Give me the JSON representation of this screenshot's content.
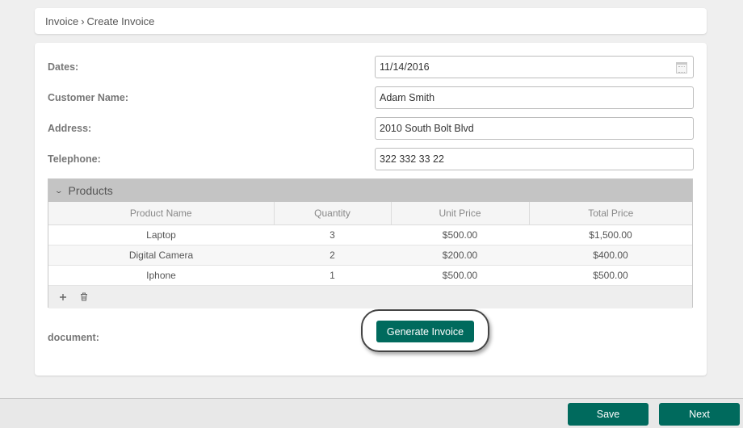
{
  "breadcrumb": {
    "parent": "Invoice",
    "separator": "›",
    "current": "Create Invoice"
  },
  "form": {
    "dates": {
      "label": "Dates:",
      "value": "11/14/2016"
    },
    "customer_name": {
      "label": "Customer Name:",
      "value": "Adam Smith"
    },
    "address": {
      "label": "Address:",
      "value": "2010 South Bolt Blvd"
    },
    "telephone": {
      "label": "Telephone:",
      "value": "322 332 33 22"
    }
  },
  "products": {
    "title": "Products",
    "columns": [
      "Product Name",
      "Quantity",
      "Unit Price",
      "Total Price"
    ],
    "rows": [
      [
        "Laptop",
        "3",
        "$500.00",
        "$1,500.00"
      ],
      [
        "Digital Camera",
        "2",
        "$200.00",
        "$400.00"
      ],
      [
        "Iphone",
        "1",
        "$500.00",
        "$500.00"
      ]
    ],
    "icons": {
      "add": "plus-icon",
      "delete": "trash-icon",
      "collapse": "chevron-down-icon"
    }
  },
  "document": {
    "label": "document:",
    "generate_label": "Generate Invoice"
  },
  "footer": {
    "save_label": "Save",
    "next_label": "Next"
  },
  "colors": {
    "accent": "#006a5d",
    "grid_header": "#c4c4c4",
    "background": "#efefef"
  }
}
